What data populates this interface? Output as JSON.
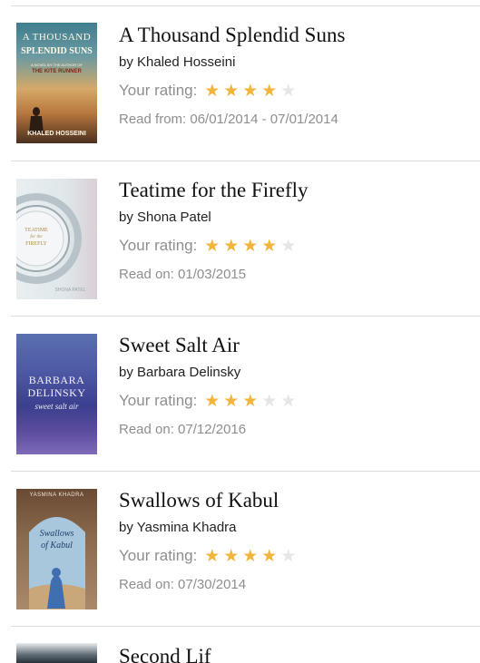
{
  "labels": {
    "rating_prefix": "Your rating:"
  },
  "colors": {
    "star_filled": "#f1b43c",
    "star_empty": "#e6e6e6",
    "secondary_text": "#8e8e8e",
    "divider": "#dcdcdc"
  },
  "books": [
    {
      "title": "A Thousand Splendid Suns",
      "author": "by Khaled Hosseini",
      "rating": 4,
      "max_rating": 5,
      "read_text": "Read from: 06/01/2014 - 07/01/2014",
      "cover": {
        "line1": "A THOUSAND",
        "line2": "SPLENDID SUNS",
        "tagline": "A NOVEL BY THE AUTHOR OF",
        "subtitle": "THE KITE RUNNER",
        "author_text": "KHALED HOSSEINI"
      }
    },
    {
      "title": "Teatime for the Firefly",
      "author": "by Shona Patel",
      "rating": 4,
      "max_rating": 5,
      "read_text": "Read on: 01/03/2015",
      "cover": {
        "line1": "TEATIME",
        "line2": "for the",
        "line3": "FIREFLY",
        "author_text": "SHONA PATEL"
      }
    },
    {
      "title": "Sweet Salt Air",
      "author": "by Barbara Delinsky",
      "rating": 3,
      "max_rating": 5,
      "read_text": "Read on: 07/12/2016",
      "cover": {
        "line1": "BARBARA",
        "line2": "DELINSKY",
        "line3": "sweet salt air"
      }
    },
    {
      "title": "Swallows of Kabul",
      "author": "by Yasmina Khadra",
      "rating": 4,
      "max_rating": 5,
      "read_text": "Read on: 07/30/2014",
      "cover": {
        "line1": "YASMINA KHADRA",
        "line2": "Swallows",
        "line3": "of Kabul"
      }
    },
    {
      "title": "Second Lif",
      "partial": true
    }
  ]
}
